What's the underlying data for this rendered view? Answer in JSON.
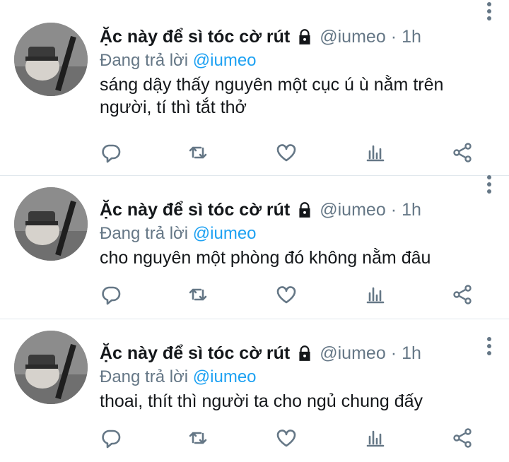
{
  "tweets": [
    {
      "display_name": "Ặc này để sì tóc cờ rút",
      "handle": "@iumeo",
      "separator": "·",
      "time": "1h",
      "replying_prefix": "Đang trả lời",
      "replying_to": "@iumeo",
      "text": "sáng dậy thấy nguyên một cục ú ù nằm trên người, tí thì tắt thở"
    },
    {
      "display_name": "Ặc này để sì tóc cờ rút",
      "handle": "@iumeo",
      "separator": "·",
      "time": "1h",
      "replying_prefix": "Đang trả lời",
      "replying_to": "@iumeo",
      "text": "cho nguyên một phòng đó không nằm đâu"
    },
    {
      "display_name": "Ặc này để sì tóc cờ rút",
      "handle": "@iumeo",
      "separator": "·",
      "time": "1h",
      "replying_prefix": "Đang trả lời",
      "replying_to": "@iumeo",
      "text": "thoai, thít thì người ta cho ngủ chung đấy"
    }
  ],
  "icons": {
    "lock": "lock-icon",
    "more": "more-vertical-icon",
    "reply": "reply-icon",
    "retweet": "retweet-icon",
    "like": "heart-icon",
    "analytics": "analytics-icon",
    "share": "share-icon"
  },
  "colors": {
    "text": "#14171a",
    "secondary": "#657786",
    "mention": "#1da1f2",
    "divider": "#e1e8ed"
  }
}
